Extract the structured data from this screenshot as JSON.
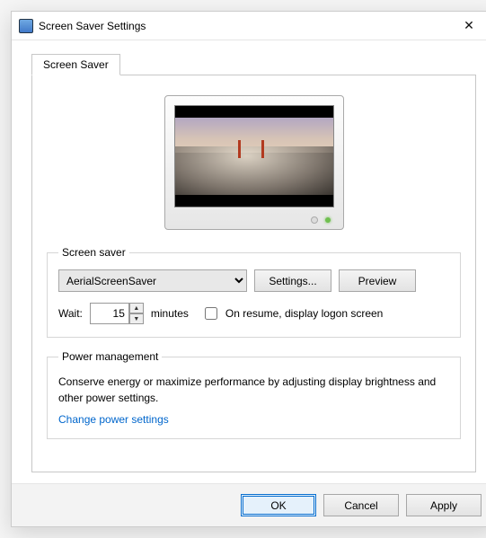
{
  "window": {
    "title": "Screen Saver Settings",
    "close_glyph": "✕"
  },
  "tab": {
    "label": "Screen Saver"
  },
  "screensaver_group": {
    "legend": "Screen saver",
    "dropdown_value": "AerialScreenSaver",
    "settings_btn": "Settings...",
    "preview_btn": "Preview",
    "wait_label": "Wait:",
    "wait_value": "15",
    "minutes_label": "minutes",
    "resume_checkbox_label": "On resume, display logon screen",
    "resume_checked": false
  },
  "power_group": {
    "legend": "Power management",
    "text": "Conserve energy or maximize performance by adjusting display brightness and other power settings.",
    "link": "Change power settings"
  },
  "footer": {
    "ok": "OK",
    "cancel": "Cancel",
    "apply": "Apply"
  }
}
